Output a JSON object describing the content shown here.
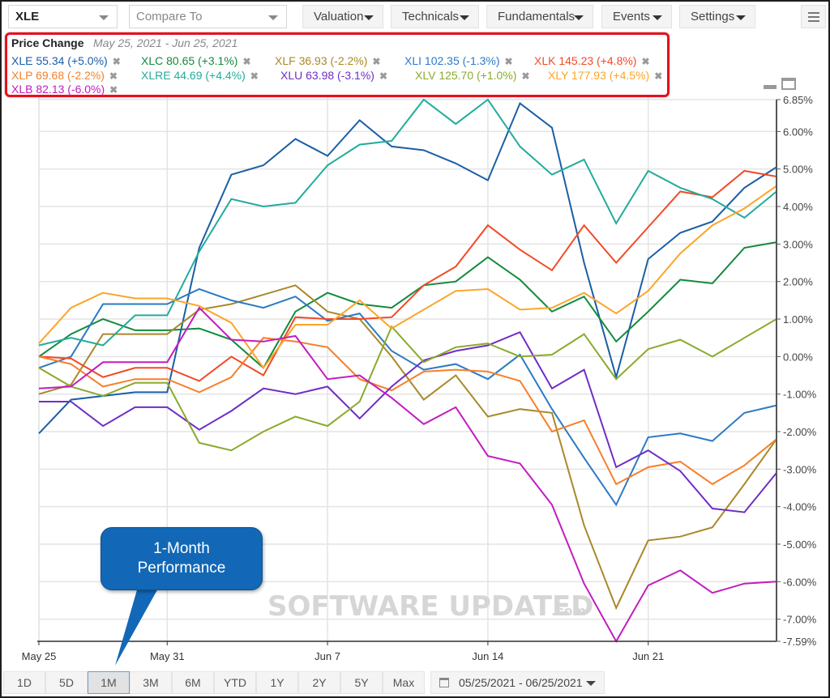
{
  "toolbar": {
    "symbol": "XLE",
    "compare_placeholder": "Compare To",
    "menus": [
      "Valuation",
      "Technicals",
      "Fundamentals",
      "Events",
      "Settings"
    ],
    "menu_icon": "hamburger-icon"
  },
  "legend": {
    "title": "Price Change",
    "range": "May 25, 2021 - Jun 25, 2021",
    "remove_icon": "✖"
  },
  "callout": {
    "line1": "1-Month",
    "line2": "Performance"
  },
  "watermark": {
    "main": "SOFTWARE UPDATED",
    "suffix": ".com"
  },
  "range_selector": {
    "buttons": [
      "1D",
      "5D",
      "1M",
      "3M",
      "6M",
      "YTD",
      "1Y",
      "2Y",
      "5Y",
      "Max"
    ],
    "active": "1M",
    "date_range": "05/25/2021 - 06/25/2021"
  },
  "chart_data": {
    "type": "line",
    "title": "Price Change",
    "subtitle": "May 25, 2021 - Jun 25, 2021",
    "xlabel": "",
    "ylabel": "",
    "y_unit": "%",
    "ylim": [
      -7.59,
      6.85
    ],
    "y_ticks": [
      "6.85%",
      "6.00%",
      "5.00%",
      "4.00%",
      "3.00%",
      "2.00%",
      "1.00%",
      "0.00%",
      "-1.00%",
      "-2.00%",
      "-3.00%",
      "-4.00%",
      "-5.00%",
      "-6.00%",
      "-7.00%",
      "-7.59%"
    ],
    "y_tick_values": [
      6.85,
      6,
      5,
      4,
      3,
      2,
      1,
      0,
      -1,
      -2,
      -3,
      -4,
      -5,
      -6,
      -7,
      -7.59
    ],
    "x_ticks": [
      {
        "label": "May 25",
        "index": 0
      },
      {
        "label": "May 31",
        "index": 4
      },
      {
        "label": "Jun 7",
        "index": 9
      },
      {
        "label": "Jun 14",
        "index": 14
      },
      {
        "label": "Jun 21",
        "index": 19
      }
    ],
    "x_count": 24,
    "grid": true,
    "y_axis_position": "right",
    "legend_position": "top-left",
    "series": [
      {
        "name": "XLE",
        "label": "XLE 55.34 (+5.0%)",
        "color": "#1a5ea6",
        "values": [
          -2.05,
          -1.15,
          -1.05,
          -0.95,
          -0.95,
          2.9,
          4.85,
          5.1,
          5.8,
          5.35,
          6.3,
          5.6,
          5.5,
          5.15,
          4.7,
          6.75,
          6.1,
          2.5,
          -0.55,
          2.6,
          3.3,
          3.6,
          4.5,
          5.05
        ]
      },
      {
        "name": "XLC",
        "label": "XLC 80.65 (+3.1%)",
        "color": "#128a3c",
        "values": [
          0.0,
          0.6,
          1.0,
          0.7,
          0.7,
          0.75,
          0.45,
          -0.3,
          1.2,
          1.7,
          1.4,
          1.3,
          1.9,
          2.0,
          2.65,
          2.05,
          1.2,
          1.6,
          0.4,
          1.2,
          2.05,
          1.95,
          2.9,
          3.05
        ]
      },
      {
        "name": "XLF",
        "label": "XLF 36.93 (-2.2%)",
        "color": "#a8892a",
        "values": [
          -1.0,
          -0.75,
          0.6,
          0.6,
          0.6,
          1.25,
          1.4,
          1.65,
          1.9,
          1.2,
          1.0,
          0.0,
          -1.15,
          -0.5,
          -1.6,
          -1.4,
          -1.5,
          -4.5,
          -6.7,
          -4.9,
          -4.8,
          -4.55,
          -3.4,
          -2.2
        ]
      },
      {
        "name": "XLI",
        "label": "XLI 102.35 (-1.3%)",
        "color": "#2b7ac4",
        "values": [
          -0.3,
          0.0,
          1.4,
          1.4,
          1.4,
          1.8,
          1.5,
          1.3,
          1.6,
          0.95,
          1.15,
          0.15,
          -0.35,
          -0.2,
          -0.6,
          0.05,
          -1.4,
          -2.7,
          -3.95,
          -2.15,
          -2.05,
          -2.25,
          -1.5,
          -1.3
        ]
      },
      {
        "name": "XLK",
        "label": "XLK 145.23 (+4.8%)",
        "color": "#f24a26",
        "values": [
          0.0,
          -0.05,
          -0.55,
          -0.3,
          -0.3,
          -0.65,
          0.0,
          -0.5,
          1.05,
          1.0,
          1.0,
          1.05,
          1.9,
          2.4,
          3.5,
          2.85,
          2.3,
          3.5,
          2.5,
          3.45,
          4.4,
          4.25,
          4.95,
          4.8
        ]
      },
      {
        "name": "XLP",
        "label": "XLP 69.68 (-2.2%)",
        "color": "#f77f2a",
        "values": [
          0.0,
          -0.2,
          -0.8,
          -0.6,
          -0.6,
          -0.95,
          -0.55,
          0.5,
          0.4,
          0.25,
          -0.6,
          -0.9,
          -0.4,
          -0.35,
          -0.4,
          -0.65,
          -2.0,
          -1.7,
          -3.4,
          -2.95,
          -2.8,
          -3.4,
          -2.9,
          -2.2
        ]
      },
      {
        "name": "XLRE",
        "label": "XLRE 44.69 (+4.4%)",
        "color": "#22ac9c",
        "values": [
          0.3,
          0.5,
          0.3,
          1.1,
          1.1,
          2.8,
          4.2,
          4.0,
          4.1,
          5.1,
          5.65,
          5.75,
          6.85,
          6.2,
          6.85,
          5.6,
          4.85,
          5.25,
          3.55,
          4.95,
          4.5,
          4.2,
          3.7,
          4.4
        ]
      },
      {
        "name": "XLU",
        "label": "XLU 63.98 (-3.1%)",
        "color": "#6f2dc6",
        "values": [
          -1.2,
          -1.2,
          -1.85,
          -1.35,
          -1.35,
          -1.95,
          -1.45,
          -0.85,
          -1.0,
          -0.8,
          -1.65,
          -0.8,
          -0.1,
          0.15,
          0.3,
          0.65,
          -0.85,
          -0.35,
          -2.95,
          -2.5,
          -3.05,
          -4.05,
          -4.15,
          -3.1
        ]
      },
      {
        "name": "XLV",
        "label": "XLV 125.70 (+1.0%)",
        "color": "#8aaa2c",
        "values": [
          -0.3,
          -0.8,
          -1.05,
          -0.7,
          -0.7,
          -2.3,
          -2.5,
          -2.0,
          -1.6,
          -1.85,
          -1.2,
          0.8,
          -0.15,
          0.25,
          0.35,
          0.0,
          0.05,
          0.6,
          -0.6,
          0.2,
          0.45,
          0.0,
          0.5,
          1.0
        ]
      },
      {
        "name": "XLY",
        "label": "XLY 177.93 (+4.5%)",
        "color": "#fba52a",
        "values": [
          0.35,
          1.3,
          1.7,
          1.55,
          1.55,
          1.35,
          0.9,
          -0.3,
          0.85,
          0.85,
          1.5,
          0.75,
          1.25,
          1.75,
          1.8,
          1.25,
          1.3,
          1.7,
          1.15,
          1.75,
          2.75,
          3.5,
          3.95,
          4.55
        ]
      },
      {
        "name": "XLB",
        "label": "XLB 82.13 (-6.0%)",
        "color": "#c21cc0",
        "values": [
          -0.85,
          -0.8,
          -0.15,
          -0.15,
          -0.15,
          1.3,
          0.45,
          0.4,
          0.55,
          -0.6,
          -0.5,
          -1.1,
          -1.8,
          -1.35,
          -2.65,
          -2.85,
          -3.95,
          -6.05,
          -7.59,
          -6.1,
          -5.7,
          -6.3,
          -6.05,
          -6.0
        ]
      }
    ]
  }
}
